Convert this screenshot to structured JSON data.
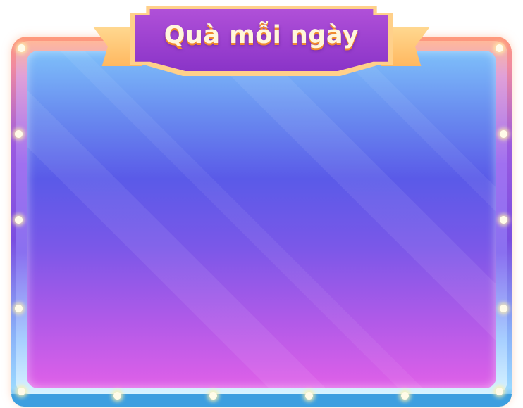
{
  "header": {
    "title": "Quà mỗi ngày"
  },
  "colors": {
    "panel_top": "#7ec0fa",
    "panel_mid": "#5a5ae8",
    "panel_bottom": "#e060e8",
    "banner": "#9a3ed0",
    "title_shadow": "#f08a30"
  }
}
